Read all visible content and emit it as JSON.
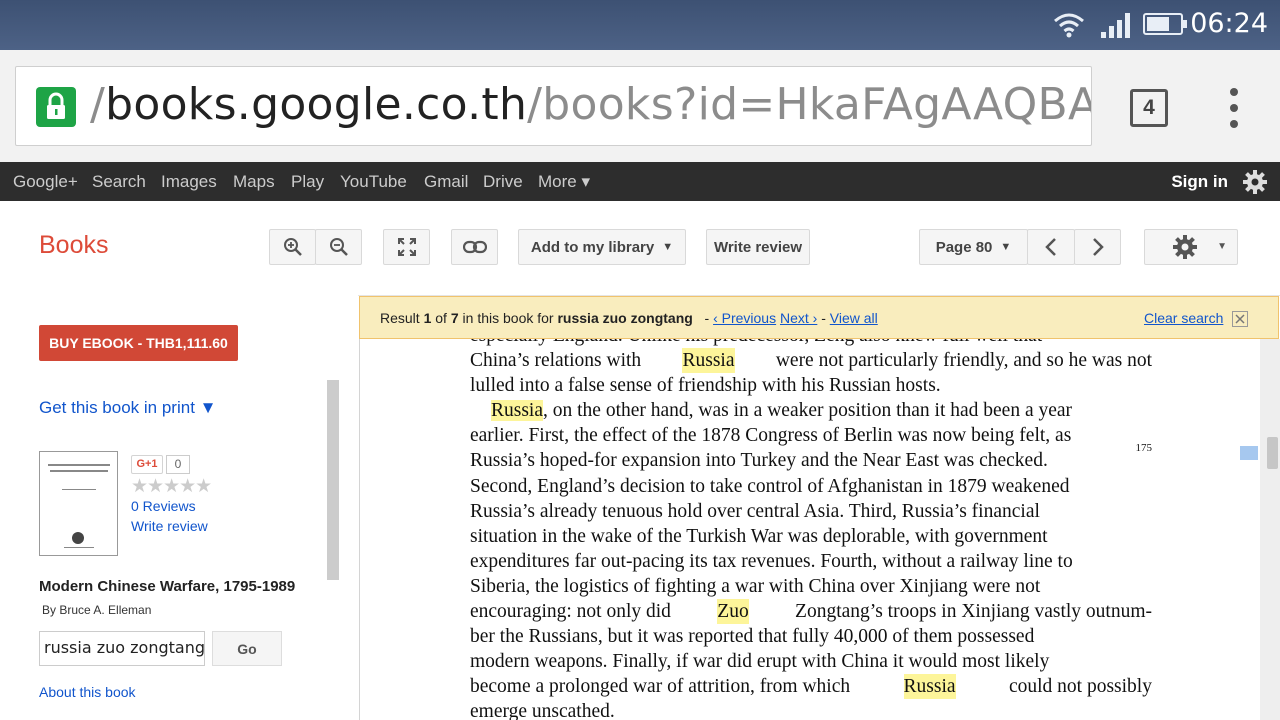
{
  "status": {
    "time": "06:24"
  },
  "browser": {
    "url_prefix": "/",
    "url_host": "books.google.co.th",
    "url_path": "/books?id=HkaFAgAAQBAJ&p",
    "tab_count": "4"
  },
  "google_bar": {
    "items": [
      "Google+",
      "Search",
      "Images",
      "Maps",
      "Play",
      "YouTube",
      "Gmail",
      "Drive",
      "More ▾"
    ],
    "sign_in": "Sign in"
  },
  "books_header": {
    "title": "Books",
    "add_library": "Add to my library",
    "write_review": "Write review",
    "page": "Page 80"
  },
  "sidebar": {
    "buy_label": "BUY EBOOK - THB1,111.60",
    "get_print": "Get this book in print ▼",
    "gplus": "G+1",
    "gplus_count": "0",
    "stars": "★★★★★",
    "reviews": "0 Reviews",
    "write_review": "Write review",
    "book_title": "Modern Chinese Warfare, 1795-1989",
    "byline": "By Bruce A. Elleman",
    "search_value": "russia zuo zongtang",
    "go": "Go",
    "about": "About this book"
  },
  "result_bar": {
    "result": "Result",
    "num": "1",
    "of": "of",
    "total": "7",
    "in_book": "in this book for",
    "query": "russia zuo zongtang",
    "sep1": "-",
    "prev": "‹ Previous",
    "next": "Next ›",
    "sep2": "-",
    "view_all": "View all",
    "clear": "Clear search"
  },
  "page_text": {
    "l0": "especially England. Unlike his predecessor, Zeng also knew full well that",
    "l1a": "China’s relations with",
    "l1b": "Russia",
    "l1c": "were not particularly friendly, and so he was not",
    "l2": "lulled into a false sense of friendship with his Russian hosts.",
    "l3a": "Russia",
    "l3b": ", on the other hand, was in a weaker position than it had been a year",
    "l4": "earlier. First, the effect of the 1878 Congress of Berlin was now being felt, as",
    "l5": "Russia’s hoped-for expansion into Turkey and the Near East was checked.",
    "l5sup": "175",
    "l6": "Second, England’s decision to take control of Afghanistan in 1879 weakened",
    "l7": "Russia’s already tenuous hold over central Asia. Third, Russia’s financial",
    "l8": "situation in the wake of the Turkish War was deplorable, with government",
    "l9": "expenditures far out-pacing its tax revenues. Fourth, without a railway line to",
    "l10": "Siberia, the logistics of fighting a war with China over Xinjiang were not",
    "l11a": "encouraging: not only did",
    "l11b": "Zuo",
    "l11c": "Zongtang’s troops in Xinjiang vastly outnum-",
    "l12": "ber the Russians, but it was reported that fully 40,000 of them possessed",
    "l13": "modern weapons. Finally, if war did erupt with China it would most likely",
    "l14a": "become a prolonged war of attrition, from which",
    "l14b": "Russia",
    "l14c": "could not possibly",
    "l15": "emerge unscathed."
  }
}
